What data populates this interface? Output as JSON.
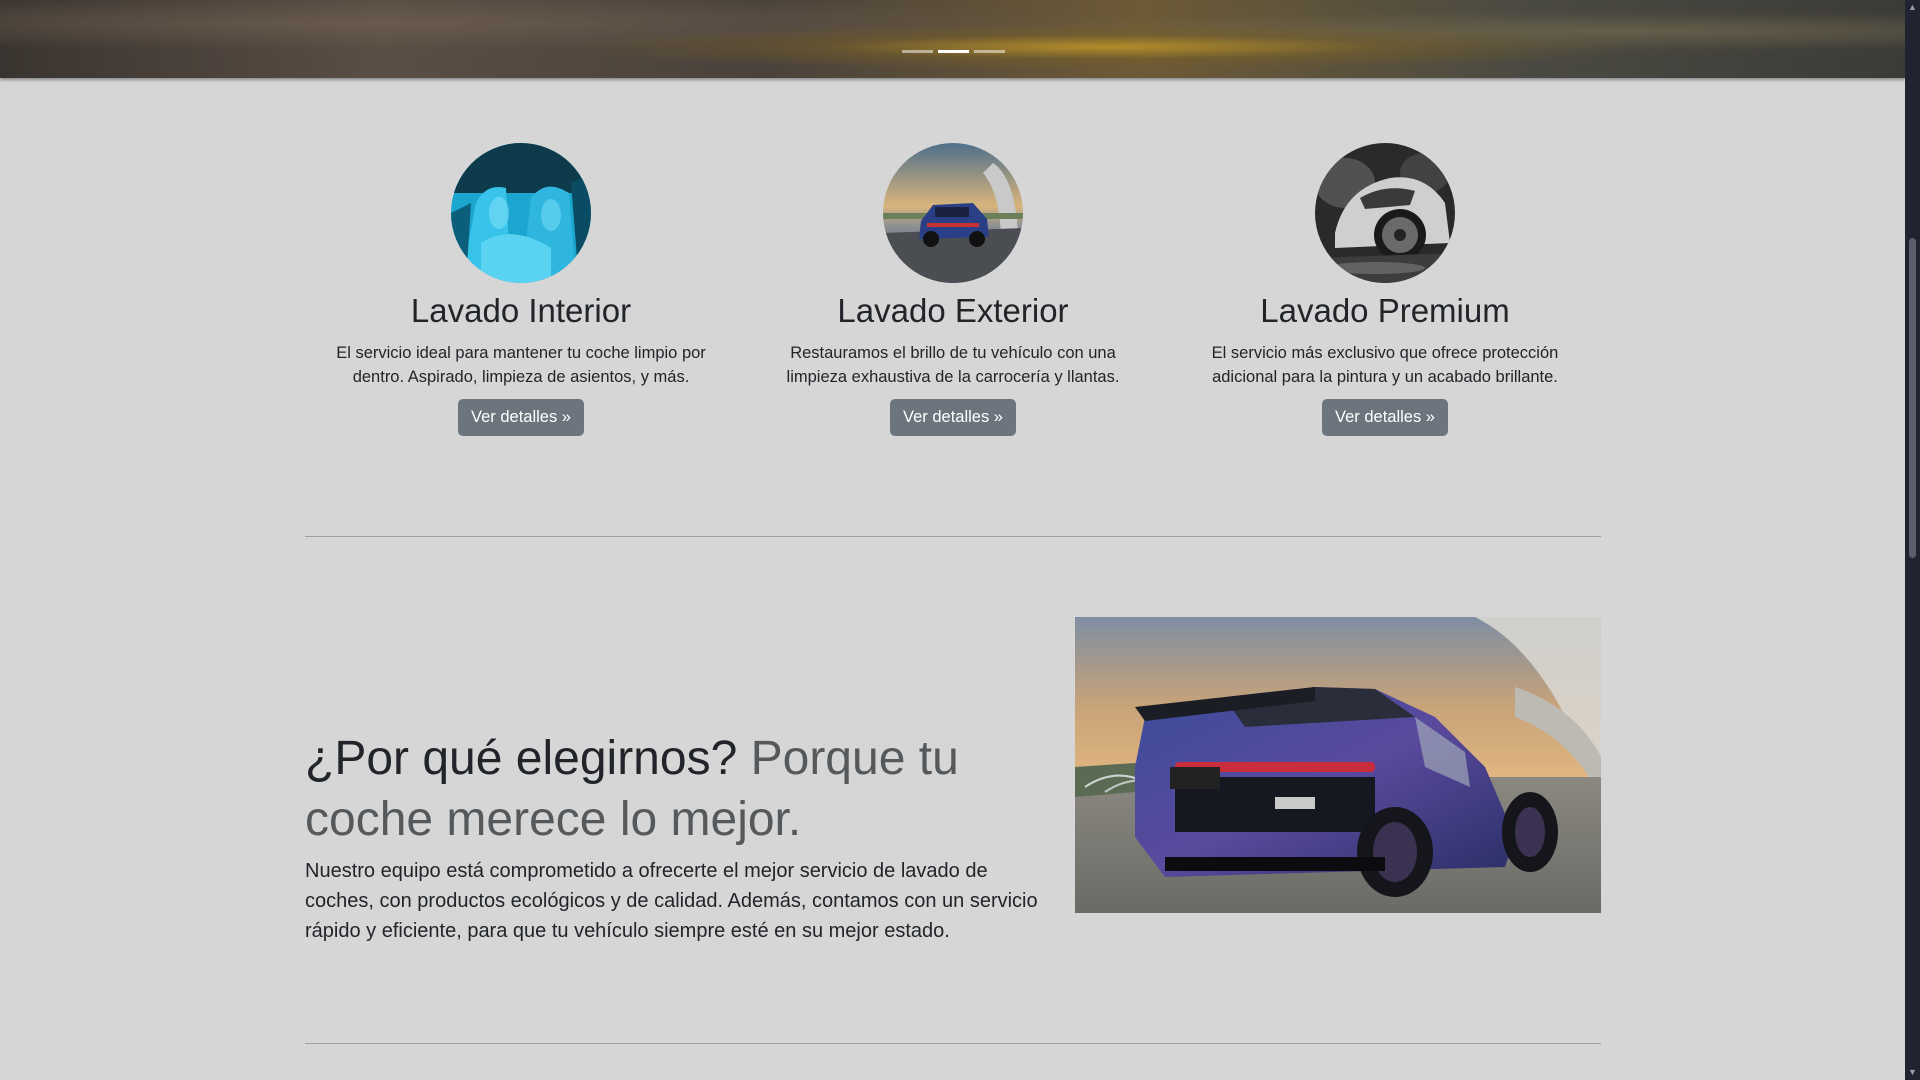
{
  "carousel": {
    "slides": [
      "Slide 1",
      "Slide 2",
      "Slide 3"
    ],
    "active_index": 1
  },
  "services": [
    {
      "title": "Lavado Interior",
      "description": "El servicio ideal para mantener tu coche limpio por dentro. Aspirado, limpieza de asientos, y más.",
      "button": "Ver detalles »",
      "image": "car-interior-seats-image"
    },
    {
      "title": "Lavado Exterior",
      "description": "Restauramos el brillo de tu vehículo con una limpieza exhaustiva de la carrocería y llantas.",
      "button": "Ver detalles »",
      "image": "suv-on-road-image"
    },
    {
      "title": "Lavado Premium",
      "description": "El servicio más exclusivo que ofrece protección adicional para la pintura y un acabado brillante.",
      "button": "Ver detalles »",
      "image": "car-foam-wash-image"
    }
  ],
  "featurette": {
    "heading": "¿Por qué elegirnos?",
    "heading_muted": "Porque tu coche merece lo mejor.",
    "body": "Nuestro equipo está comprometido a ofrecerte el mejor servicio de lavado de coches, con productos ecológicos y de calidad. Además, contamos con un servicio rápido y eficiente, para que tu vehículo siempre esté en su mejor estado.",
    "image": "blue-suv-rear-image"
  },
  "colors": {
    "background": "#d6d6d6",
    "button": "#6c757d",
    "muted_text": "#55595c"
  }
}
